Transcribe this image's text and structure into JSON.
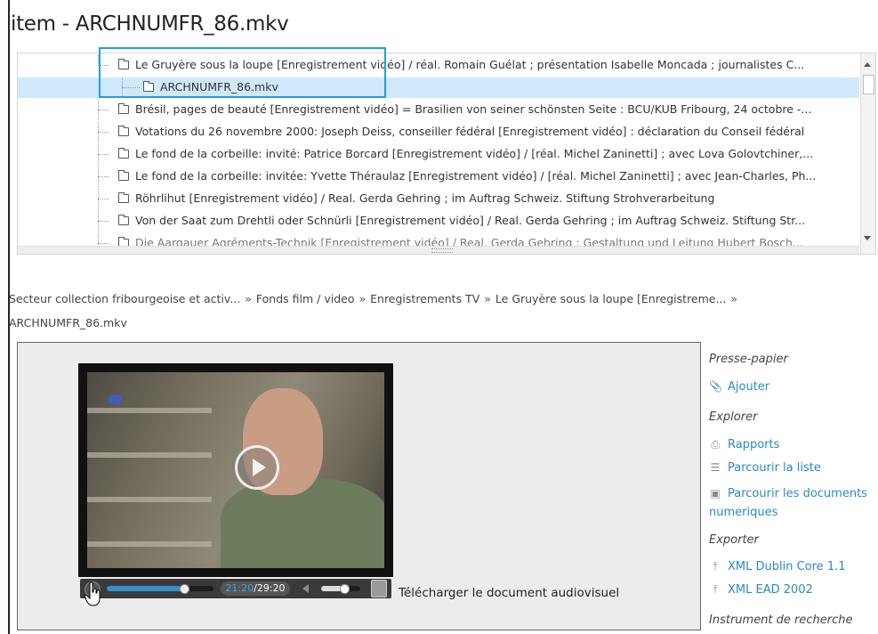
{
  "page": {
    "title": "item - ARCHNUMFR_86.mkv"
  },
  "tree": {
    "items": [
      {
        "label": "Le Gruyère sous la loupe [Enregistrement vidéo] / réal. Romain Guélat ; présentation Isabelle Moncada ; journalistes C...",
        "expanded": true
      },
      {
        "label": "ARCHNUMFR_86.mkv",
        "selected": true
      },
      {
        "label": "Brésil, pages de beauté [Enregistrement vidéo] = Brasilien von seiner schönsten Seite : BCU/KUB Fribourg, 24 octobre -..."
      },
      {
        "label": "Votations du 26 novembre 2000: Joseph Deiss, conseiller fédéral [Enregistrement vidéo] : déclaration du Conseil fédéral"
      },
      {
        "label": "Le fond de la corbeille: invité: Patrice Borcard [Enregistrement vidéo] / [réal. Michel Zaninetti] ; avec Lova Golovtchiner,..."
      },
      {
        "label": "Le fond de la corbeille: invitée: Yvette Théraulaz [Enregistrement vidéo] / [réal. Michel Zaninetti] ; avec Jean-Charles, Ph..."
      },
      {
        "label": "Röhrlihut [Enregistrement vidéo] / Real. Gerda Gehring ; im Auftrag Schweiz. Stiftung Strohverarbeitung"
      },
      {
        "label": "Von der Saat zum Drehtli oder Schnürli [Enregistrement vidéo] / Real. Gerda Gehring ; im Auftrag Schweiz. Stiftung Str..."
      },
      {
        "label": "Die Aargauer Agréments-Technik [Enregistrement vidéo] / Real. Gerda Gehring : Gestaltung und Leitung Hubert Bosch..."
      }
    ]
  },
  "breadcrumb": {
    "items": [
      "Secteur collection fribourgeoise et activ...",
      "Fonds film / video",
      "Enregistrements TV",
      "Le Gruyère sous la loupe [Enregistreme..."
    ],
    "current": "ARCHNUMFR_86.mkv",
    "separator": "»"
  },
  "player": {
    "current_time": "21:20",
    "total_time": "29:20",
    "progress": 0.727,
    "volume": 0.6,
    "download_label": "Télécharger le document audiovisuel"
  },
  "sidebar": {
    "sections": [
      {
        "heading": "Presse-papier",
        "links": [
          {
            "label": "Ajouter",
            "icon": "paperclip-icon"
          }
        ]
      },
      {
        "heading": "Explorer",
        "links": [
          {
            "label": "Rapports",
            "icon": "printer-icon"
          },
          {
            "label": "Parcourir la liste",
            "icon": "list-icon"
          },
          {
            "label": "Parcourir les documents numeriques",
            "icon": "image-icon"
          }
        ]
      },
      {
        "heading": "Exporter",
        "links": [
          {
            "label": "XML Dublin Core 1.1",
            "icon": "upload-icon"
          },
          {
            "label": "XML EAD 2002",
            "icon": "upload-icon"
          }
        ]
      },
      {
        "heading": "Instrument de recherche",
        "links": []
      }
    ]
  },
  "colors": {
    "link": "#2a88c8",
    "selection": "#cfe9fb",
    "highlight_box": "#1ea0e0",
    "seek_fill": "#3c8ec7"
  }
}
